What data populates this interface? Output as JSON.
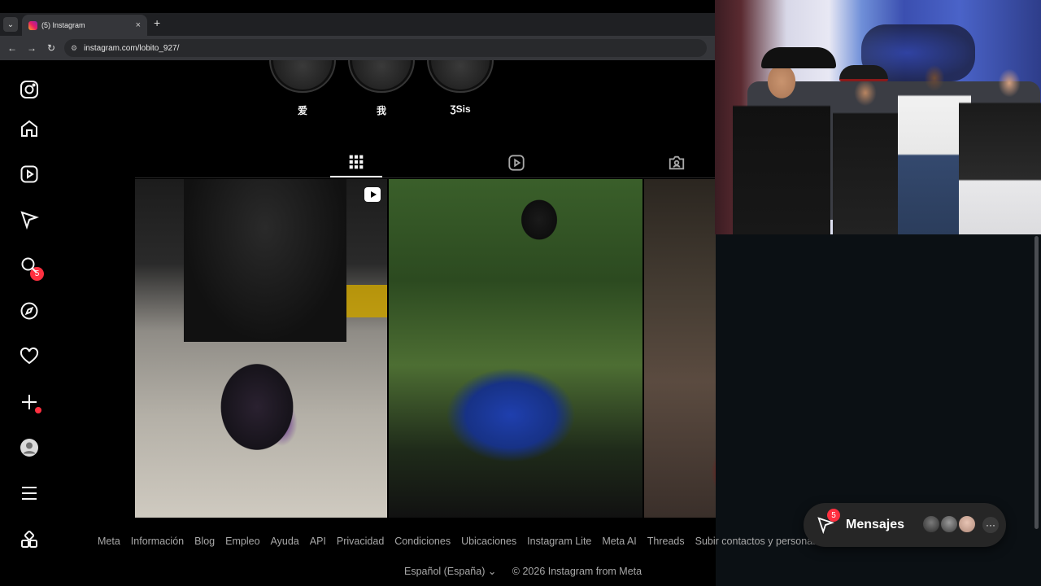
{
  "browser": {
    "tab_title": "(5) Instagram",
    "tab_close": "×",
    "new_tab": "+",
    "url": "instagram.com/lobito_927/"
  },
  "nav": {
    "messages_badge": "5"
  },
  "stories": [
    {
      "label": "爱"
    },
    {
      "label": "我"
    },
    {
      "label": "ƷSis"
    }
  ],
  "footer": {
    "links": [
      "Meta",
      "Información",
      "Blog",
      "Empleo",
      "Ayuda",
      "API",
      "Privacidad",
      "Condiciones",
      "Ubicaciones",
      "Instagram Lite",
      "Meta AI",
      "Threads",
      "Subir contactos y personas"
    ],
    "language": "Español (España) ⌄",
    "copyright": "© 2026 Instagram from Meta"
  },
  "messages_pill": {
    "label": "Mensajes",
    "badge": "5",
    "more": "···"
  },
  "colors": {
    "badge": "#ff3040",
    "background": "#000000"
  }
}
